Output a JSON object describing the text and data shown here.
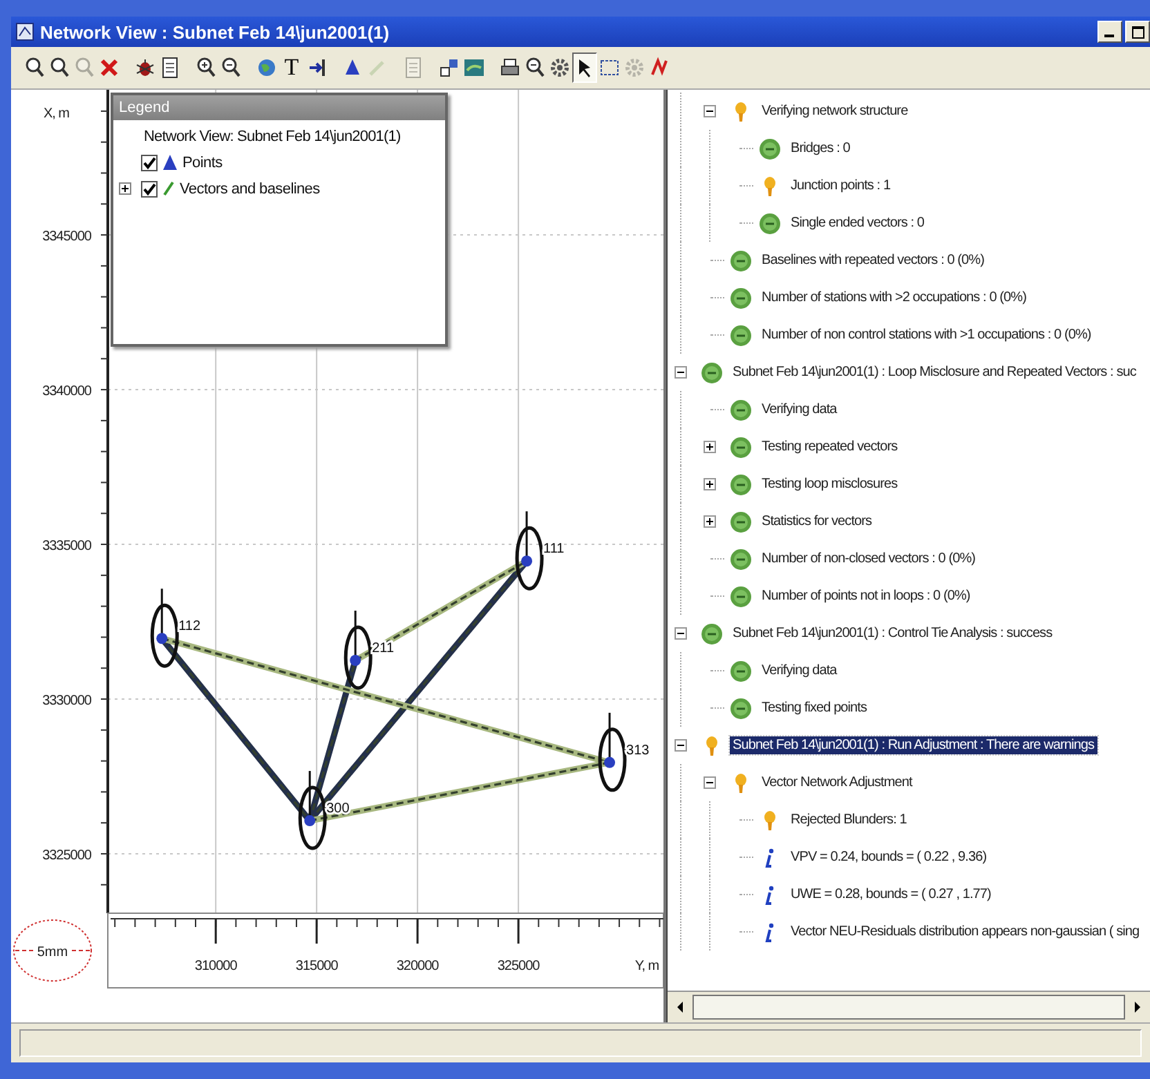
{
  "window": {
    "title": "Network View : Subnet Feb 14\\jun2001(1)"
  },
  "toolbar": [
    {
      "kind": "zoom",
      "disabled": false,
      "selected": false
    },
    {
      "kind": "zoom",
      "disabled": false,
      "selected": false
    },
    {
      "kind": "zoom",
      "disabled": true,
      "selected": false
    },
    {
      "kind": "delete",
      "disabled": false,
      "selected": false
    },
    {
      "kind": "separator"
    },
    {
      "kind": "bug",
      "disabled": false,
      "selected": false
    },
    {
      "kind": "document",
      "disabled": false,
      "selected": false
    },
    {
      "kind": "separator"
    },
    {
      "kind": "zoom-in",
      "disabled": false,
      "selected": false
    },
    {
      "kind": "zoom-out",
      "disabled": false,
      "selected": false
    },
    {
      "kind": "separator"
    },
    {
      "kind": "globe",
      "disabled": false,
      "selected": false
    },
    {
      "kind": "text",
      "label": "T",
      "disabled": false,
      "selected": false
    },
    {
      "kind": "fit",
      "disabled": false,
      "selected": false
    },
    {
      "kind": "separator"
    },
    {
      "kind": "point",
      "disabled": false,
      "selected": false
    },
    {
      "kind": "pencil",
      "disabled": true,
      "selected": false
    },
    {
      "kind": "separator"
    },
    {
      "kind": "document",
      "disabled": true,
      "selected": false
    },
    {
      "kind": "separator"
    },
    {
      "kind": "network",
      "disabled": false,
      "selected": false
    },
    {
      "kind": "map",
      "disabled": false,
      "selected": false
    },
    {
      "kind": "separator"
    },
    {
      "kind": "print",
      "disabled": false,
      "selected": false
    },
    {
      "kind": "preview",
      "disabled": false,
      "selected": false
    },
    {
      "kind": "gears",
      "disabled": false,
      "selected": false
    },
    {
      "kind": "pointer",
      "disabled": false,
      "selected": true
    },
    {
      "kind": "select",
      "disabled": false,
      "selected": false
    },
    {
      "kind": "gear",
      "disabled": true,
      "selected": false
    },
    {
      "kind": "vector",
      "disabled": false,
      "selected": false
    }
  ],
  "plot": {
    "legend": {
      "title": "Legend",
      "heading": "Network View: Subnet Feb 14\\jun2001(1)",
      "items": [
        {
          "label": "Points",
          "kind": "points",
          "checked": true
        },
        {
          "label": "Vectors and baselines",
          "kind": "vectors",
          "checked": true,
          "expanded": false
        }
      ]
    },
    "scale_label": "5mm",
    "chart_data": {
      "type": "scatter",
      "grid": true,
      "xlabel": "Y, m",
      "ylabel": "X, m",
      "xlim": [
        304650,
        332190
      ],
      "ylim": [
        3323080,
        3349690
      ],
      "xticks": [
        {
          "value": 310000,
          "label": "310000"
        },
        {
          "value": 315000,
          "label": "315000"
        },
        {
          "value": 320000,
          "label": "320000"
        },
        {
          "value": 325000,
          "label": "325000"
        }
      ],
      "yticks": [
        {
          "value": 3325000,
          "label": "3325000"
        },
        {
          "value": 3330000,
          "label": "3330000"
        },
        {
          "value": 3335000,
          "label": "3335000"
        },
        {
          "value": 3340000,
          "label": "3340000"
        },
        {
          "value": 3345000,
          "label": "3345000"
        }
      ],
      "x": [
        307330,
        314660,
        316920,
        325410,
        329520
      ],
      "series": [
        {
          "color": "#2a3fc0",
          "values": [
            3331960,
            3326070,
            3331250,
            3334460,
            3327950
          ]
        },
        {
          "type": "line",
          "color": "#24304a",
          "values": [
            3331960,
            3326070,
            null,
            null,
            null
          ]
        },
        {
          "type": "line",
          "color": "#24304a",
          "values": [
            null,
            3326070,
            3331250,
            null,
            null
          ]
        },
        {
          "type": "line",
          "color": "#24304a",
          "values": [
            null,
            3326070,
            null,
            3334460,
            null
          ]
        },
        {
          "type": "line",
          "color": "#a8b880",
          "values": [
            3331960,
            null,
            null,
            null,
            3327950
          ]
        },
        {
          "type": "line",
          "color": "#a8b880",
          "values": [
            null,
            null,
            3331250,
            3334460,
            null
          ]
        },
        {
          "type": "line",
          "color": "#a8b880",
          "values": [
            null,
            3326070,
            null,
            null,
            3327950
          ]
        }
      ],
      "annotations": [
        {
          "text": "112",
          "x": 307330,
          "y": 3331960
        },
        {
          "text": "300",
          "x": 314660,
          "y": 3326070
        },
        {
          "text": "211",
          "x": 316920,
          "y": 3331250
        },
        {
          "text": "111",
          "x": 325410,
          "y": 3334460
        },
        {
          "text": "313",
          "x": 329520,
          "y": 3327950
        }
      ]
    }
  },
  "tree": {
    "continued_children": [
      {
        "text": "Verifying network structure",
        "kind": "warning",
        "selected": false,
        "expanded": true,
        "children": [
          {
            "text": "Bridges : 0",
            "kind": "ok",
            "selected": false
          },
          {
            "text": "Junction points : 1",
            "kind": "warning",
            "selected": false
          },
          {
            "text": "Single ended vectors : 0",
            "kind": "ok",
            "selected": false
          }
        ]
      },
      {
        "text": "Baselines with repeated vectors : 0 (0%)",
        "kind": "ok",
        "selected": false
      },
      {
        "text": "Number of stations with >2 occupations : 0 (0%)",
        "kind": "ok",
        "selected": false
      },
      {
        "text": "Number of non control stations with >1 occupations : 0 (0%)",
        "kind": "ok",
        "selected": false
      }
    ],
    "items": [
      {
        "text": "Subnet Feb 14\\jun2001(1) : Loop Misclosure and Repeated Vectors : suc",
        "kind": "ok",
        "selected": false,
        "expanded": true,
        "children": [
          {
            "text": "Verifying data",
            "kind": "ok",
            "selected": false
          },
          {
            "text": "Testing repeated vectors",
            "kind": "ok",
            "selected": false,
            "expanded": false
          },
          {
            "text": "Testing loop misclosures",
            "kind": "ok",
            "selected": false,
            "expanded": false
          },
          {
            "text": "Statistics for vectors",
            "kind": "ok",
            "selected": false,
            "expanded": false
          },
          {
            "text": "Number of non-closed vectors : 0 (0%)",
            "kind": "ok",
            "selected": false
          },
          {
            "text": "Number of points not in loops : 0 (0%)",
            "kind": "ok",
            "selected": false
          }
        ]
      },
      {
        "text": "Subnet Feb 14\\jun2001(1) : Control Tie Analysis : success",
        "kind": "ok",
        "selected": false,
        "expanded": true,
        "children": [
          {
            "text": "Verifying data",
            "kind": "ok",
            "selected": false
          },
          {
            "text": "Testing fixed points",
            "kind": "ok",
            "selected": false
          }
        ]
      },
      {
        "text": "Subnet Feb 14\\jun2001(1) : Run Adjustment : There are warnings",
        "kind": "warning",
        "selected": true,
        "expanded": true,
        "children": [
          {
            "text": "Vector Network Adjustment",
            "kind": "warning",
            "selected": false,
            "expanded": true,
            "children": [
              {
                "text": "Rejected Blunders: 1",
                "kind": "warning",
                "selected": false
              },
              {
                "text": "VPV = 0.24, bounds = ( 0.22 , 9.36)",
                "kind": "info",
                "selected": false
              },
              {
                "text": "UWE = 0.28, bounds = ( 0.27 , 1.77)",
                "kind": "info",
                "selected": false
              },
              {
                "text": "Vector NEU-Residuals distribution appears non-gaussian ( sing",
                "kind": "info",
                "selected": false
              }
            ]
          }
        ]
      }
    ]
  }
}
